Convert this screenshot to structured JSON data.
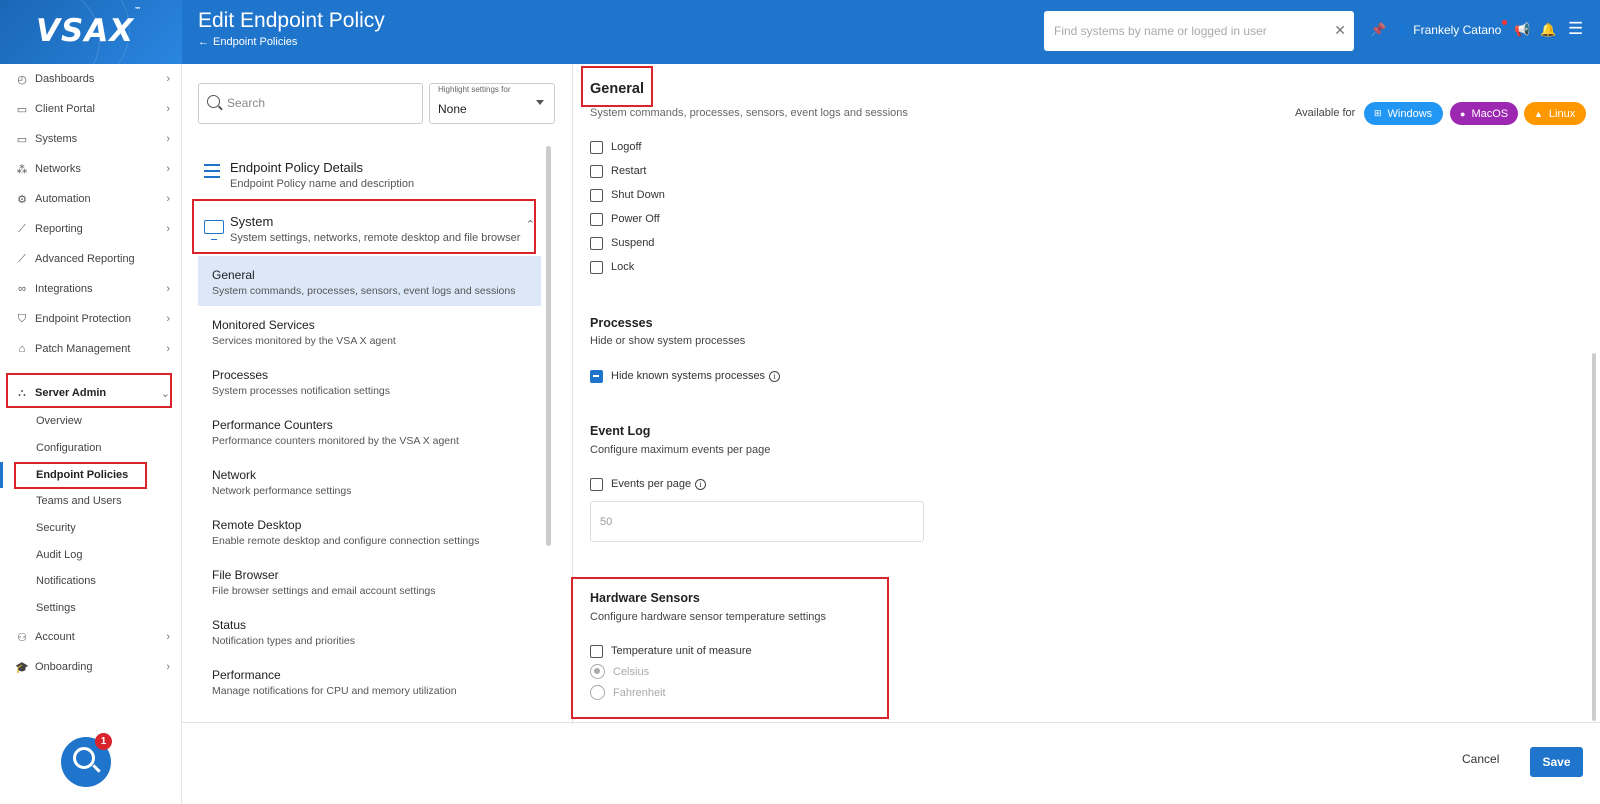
{
  "header": {
    "logo": "VSAX",
    "logo_tm": "™",
    "title": "Edit Endpoint Policy",
    "back_label": "Endpoint Policies",
    "search_placeholder": "Find systems by name or logged in user",
    "user_name": "Frankely Catano",
    "brand_color": "#1f75cb"
  },
  "sidebar": {
    "items": [
      {
        "label": "Dashboards",
        "icon": "dashboard-icon"
      },
      {
        "label": "Client Portal",
        "icon": "window-icon"
      },
      {
        "label": "Systems",
        "icon": "monitor-icon"
      },
      {
        "label": "Networks",
        "icon": "network-icon"
      },
      {
        "label": "Automation",
        "icon": "gears-icon"
      },
      {
        "label": "Reporting",
        "icon": "chart-icon"
      },
      {
        "label": "Advanced Reporting",
        "icon": "chart-icon"
      },
      {
        "label": "Integrations",
        "icon": "infinity-icon"
      },
      {
        "label": "Endpoint Protection",
        "icon": "shield-icon"
      },
      {
        "label": "Patch Management",
        "icon": "house-gear-icon"
      },
      {
        "label": "Server Admin",
        "icon": "sitemap-icon"
      }
    ],
    "server_admin_sub": [
      "Overview",
      "Configuration",
      "Endpoint Policies",
      "Teams and Users",
      "Security",
      "Audit Log",
      "Notifications",
      "Settings"
    ],
    "bottom_items": [
      {
        "label": "Account",
        "icon": "user-icon"
      },
      {
        "label": "Onboarding",
        "icon": "graduation-cap-icon"
      }
    ],
    "chat_badge": "1"
  },
  "middle": {
    "search_placeholder": "Search",
    "highlight_caption": "Highlight settings for",
    "highlight_value": "None",
    "details_title": "Endpoint Policy Details",
    "details_sub": "Endpoint Policy name and description",
    "system_title": "System",
    "system_sub": "System settings, networks, remote desktop and file browser",
    "subsections": [
      {
        "title": "General",
        "sub": "System commands, processes, sensors, event logs and sessions"
      },
      {
        "title": "Monitored Services",
        "sub": "Services monitored by the VSA X agent"
      },
      {
        "title": "Processes",
        "sub": "System processes notification settings"
      },
      {
        "title": "Performance Counters",
        "sub": "Performance counters monitored by the VSA X agent"
      },
      {
        "title": "Network",
        "sub": "Network performance settings"
      },
      {
        "title": "Remote Desktop",
        "sub": "Enable remote desktop and configure connection settings"
      },
      {
        "title": "File Browser",
        "sub": "File browser settings and email account settings"
      },
      {
        "title": "Status",
        "sub": "Notification types and priorities"
      },
      {
        "title": "Performance",
        "sub": "Manage notifications for CPU and memory utilization"
      }
    ]
  },
  "content": {
    "general_title": "General",
    "general_sub": "System commands, processes, sensors, event logs and sessions",
    "available_for": "Available for",
    "os": [
      "Windows",
      "MacOS",
      "Linux"
    ],
    "commands": [
      "Logoff",
      "Restart",
      "Shut Down",
      "Power Off",
      "Suspend",
      "Lock"
    ],
    "processes_title": "Processes",
    "processes_sub": "Hide or show system processes",
    "hide_known": "Hide known systems processes",
    "eventlog_title": "Event Log",
    "eventlog_sub": "Configure maximum events per page",
    "events_per_page": "Events per page",
    "events_value": "50",
    "hw_title": "Hardware Sensors",
    "hw_sub": "Configure hardware sensor temperature settings",
    "temp_unit": "Temperature unit of measure",
    "celsius": "Celsius",
    "fahrenheit": "Fahrenheit"
  },
  "footer": {
    "cancel": "Cancel",
    "save": "Save"
  }
}
